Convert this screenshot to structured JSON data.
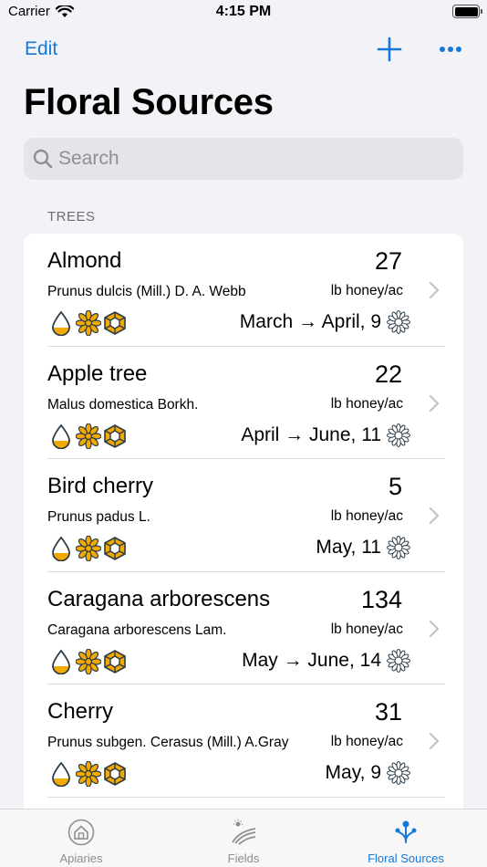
{
  "status": {
    "carrier": "Carrier",
    "time": "4:15 PM"
  },
  "nav": {
    "edit_label": "Edit"
  },
  "page": {
    "title": "Floral Sources"
  },
  "search": {
    "placeholder": "Search"
  },
  "section": {
    "header": "TREES"
  },
  "colors": {
    "accent": "#1479d9",
    "honey": "#f2a900",
    "icon_stroke": "#2b3b47"
  },
  "rows": [
    {
      "name": "Almond",
      "latin": "Prunus dulcis (Mill.) D. A. Webb",
      "count": "27",
      "unit": "lb honey/ac",
      "period": "March → April, 9"
    },
    {
      "name": "Apple tree",
      "latin": "Malus domestica Borkh.",
      "count": "22",
      "unit": "lb honey/ac",
      "period": "April → June, 11"
    },
    {
      "name": "Bird cherry",
      "latin": "Prunus padus L.",
      "count": "5",
      "unit": "lb honey/ac",
      "period": "May, 11"
    },
    {
      "name": "Caragana arborescens",
      "latin": "Caragana arborescens Lam.",
      "count": "134",
      "unit": "lb honey/ac",
      "period": "May → June, 14"
    },
    {
      "name": "Cherry",
      "latin": "Prunus subgen. Cerasus (Mill.) A.Gray",
      "count": "31",
      "unit": "lb honey/ac",
      "period": "May, 9"
    }
  ],
  "tabs": [
    {
      "label": "Apiaries",
      "icon": "house-icon"
    },
    {
      "label": "Fields",
      "icon": "field-icon"
    },
    {
      "label": "Floral Sources",
      "icon": "flower-source-icon"
    }
  ]
}
